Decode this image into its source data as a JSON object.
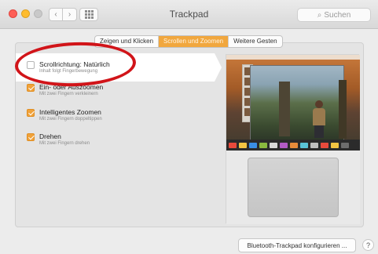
{
  "window": {
    "title": "Trackpad",
    "nav_back_icon": "‹",
    "nav_forward_icon": "›",
    "search_placeholder": "Suchen",
    "search_icon": "⌕"
  },
  "tabs": [
    {
      "label": "Zeigen und Klicken",
      "active": false
    },
    {
      "label": "Scrollen und Zoomen",
      "active": true
    },
    {
      "label": "Weitere Gesten",
      "active": false
    }
  ],
  "options": [
    {
      "title": "Scrollrichtung: Natürlich",
      "subtitle": "Inhalt folgt Fingerbewegung",
      "checked": false
    },
    {
      "title": "Ein- oder Auszoomen",
      "subtitle": "Mit zwei Fingern verkleinern",
      "checked": true
    },
    {
      "title": "Intelligentes Zoomen",
      "subtitle": "Mit zwei Fingern doppeltippen",
      "checked": true
    },
    {
      "title": "Drehen",
      "subtitle": "Mit zwei Fingern drehen",
      "checked": true
    }
  ],
  "footer": {
    "config_button": "Bluetooth-Trackpad konfigurieren ...",
    "help_label": "?"
  },
  "colors": {
    "accent": "#f1a73e",
    "annotation_ring": "#d11419"
  }
}
